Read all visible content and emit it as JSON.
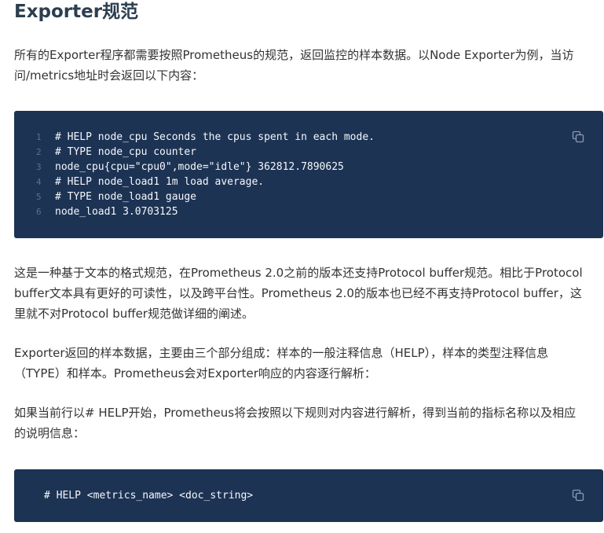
{
  "heading": "Exporter规范",
  "paragraphs": {
    "intro_line1": "所有的Exporter程序都需要按照Prometheus的规范，返回监控的样本数据。以Node Exporter为例，当访",
    "intro_line2": "问/metrics地址时会返回以下内容：",
    "format_line1": "这是一种基于文本的格式规范，在Prometheus 2.0之前的版本还支持Protocol buffer规范。相比于Protocol",
    "format_line2": "buffer文本具有更好的可读性，以及跨平台性。Prometheus 2.0的版本也已经不再支持Protocol buffer，这",
    "format_line3": "里就不对Protocol buffer规范做详细的阐述。",
    "parts_line1": "Exporter返回的样本数据，主要由三个部分组成：样本的一般注释信息（HELP），样本的类型注释信息",
    "parts_line2": "（TYPE）和样本。Prometheus会对Exporter响应的内容逐行解析：",
    "help_line1": "如果当前行以# HELP开始，Prometheus将会按照以下规则对内容进行解析，得到当前的指标名称以及相应",
    "help_line2": "的说明信息："
  },
  "code_block_1": {
    "lines": [
      {
        "num": "1",
        "text": "# HELP node_cpu Seconds the cpus spent in each mode."
      },
      {
        "num": "2",
        "text": "# TYPE node_cpu counter"
      },
      {
        "num": "3",
        "text": "node_cpu{cpu=\"cpu0\",mode=\"idle\"} 362812.7890625"
      },
      {
        "num": "4",
        "text": "# HELP node_load1 1m load average."
      },
      {
        "num": "5",
        "text": "# TYPE node_load1 gauge"
      },
      {
        "num": "6",
        "text": "node_load1 3.0703125"
      }
    ],
    "copy_icon": "copy-icon"
  },
  "code_block_2": {
    "text": "# HELP <metrics_name> <doc_string>",
    "copy_icon": "copy-icon"
  },
  "colors": {
    "code_bg": "#1d3354",
    "heading": "#2c3e50",
    "body_text": "#333333"
  }
}
